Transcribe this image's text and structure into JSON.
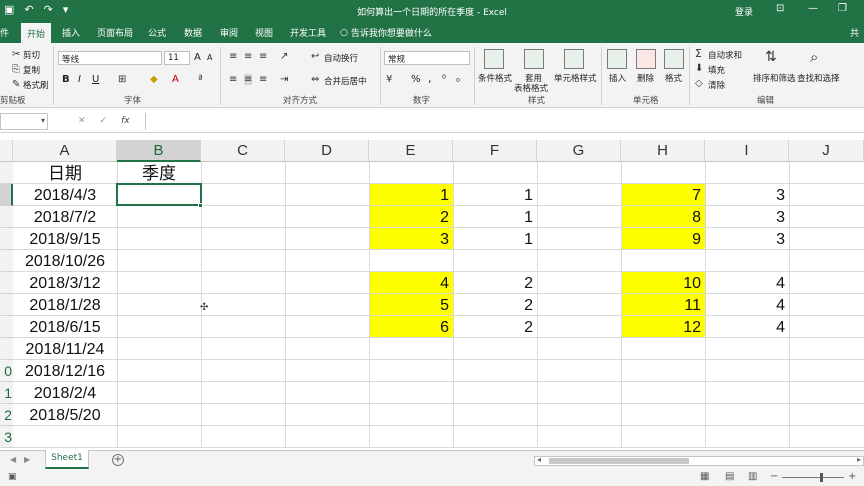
{
  "titlebar": {
    "title": "如何算出一个日期的所在季度 - Excel",
    "login": "登录",
    "qat": {
      "save": "▣",
      "undo": "↶",
      "redo": "↷",
      "customize": "▾"
    },
    "window": {
      "ribbon_opts": "⊡",
      "minimize": "—",
      "restore": "❐"
    }
  },
  "tabs": {
    "file": "件",
    "home": "开始",
    "insert": "插入",
    "page_layout": "页面布局",
    "formulas": "公式",
    "data": "数据",
    "review": "审阅",
    "view": "视图",
    "developer": "开发工具",
    "tell_me": "告诉我你想要做什么",
    "share": "共"
  },
  "ribbon": {
    "clipboard": {
      "cut": "剪切",
      "copy": "复制",
      "format_painter": "格式刷",
      "label": "剪贴板"
    },
    "font": {
      "font_name": "等线",
      "font_size": "11",
      "grow": "A",
      "shrink": "A",
      "bold": "B",
      "italic": "I",
      "underline": "U",
      "label": "字体"
    },
    "alignment": {
      "wrap": "自动换行",
      "merge": "合并后居中",
      "label": "对齐方式"
    },
    "number": {
      "format": "常规",
      "percent": "%",
      "comma": "‚",
      "label": "数字"
    },
    "styles": {
      "conditional": "条件格式",
      "table_line1": "套用",
      "table_line2": "表格格式",
      "cell_styles": "单元格样式",
      "label": "样式"
    },
    "cells": {
      "insert": "插入",
      "delete": "删除",
      "format": "格式",
      "label": "单元格"
    },
    "editing": {
      "autosum": "自动求和",
      "fill": "填充",
      "clear": "清除",
      "sort": "排序和筛选",
      "find": "查找和选择",
      "label": "编辑"
    }
  },
  "formula_bar": {
    "cancel": "✕",
    "enter": "✓",
    "fx": "fx",
    "content": ""
  },
  "grid": {
    "columns": [
      "A",
      "B",
      "C",
      "D",
      "E",
      "F",
      "G",
      "H",
      "I",
      "J"
    ],
    "selected_column": "B",
    "row_numbers": [
      "",
      "",
      "",
      "",
      "",
      "",
      "",
      "",
      "",
      "0",
      "1",
      "2",
      "3"
    ],
    "header_row": {
      "a": "日期",
      "b": "季度"
    },
    "dates": [
      "2018/4/3",
      "2018/7/2",
      "2018/9/15",
      "2018/10/26",
      "2018/3/12",
      "2018/1/28",
      "2018/6/15",
      "2018/11/24",
      "2018/12/16",
      "2018/2/4",
      "2018/5/20"
    ],
    "lookup_e": [
      "1",
      "2",
      "3",
      "",
      "4",
      "5",
      "6"
    ],
    "lookup_f": [
      "1",
      "1",
      "1",
      "",
      "2",
      "2",
      "2"
    ],
    "lookup_h": [
      "7",
      "8",
      "9",
      "",
      "10",
      "11",
      "12"
    ],
    "lookup_i": [
      "3",
      "3",
      "3",
      "",
      "4",
      "4",
      "4"
    ],
    "highlight_color": "#ffff00"
  },
  "sheets": {
    "active": "Sheet1",
    "add": "+"
  }
}
